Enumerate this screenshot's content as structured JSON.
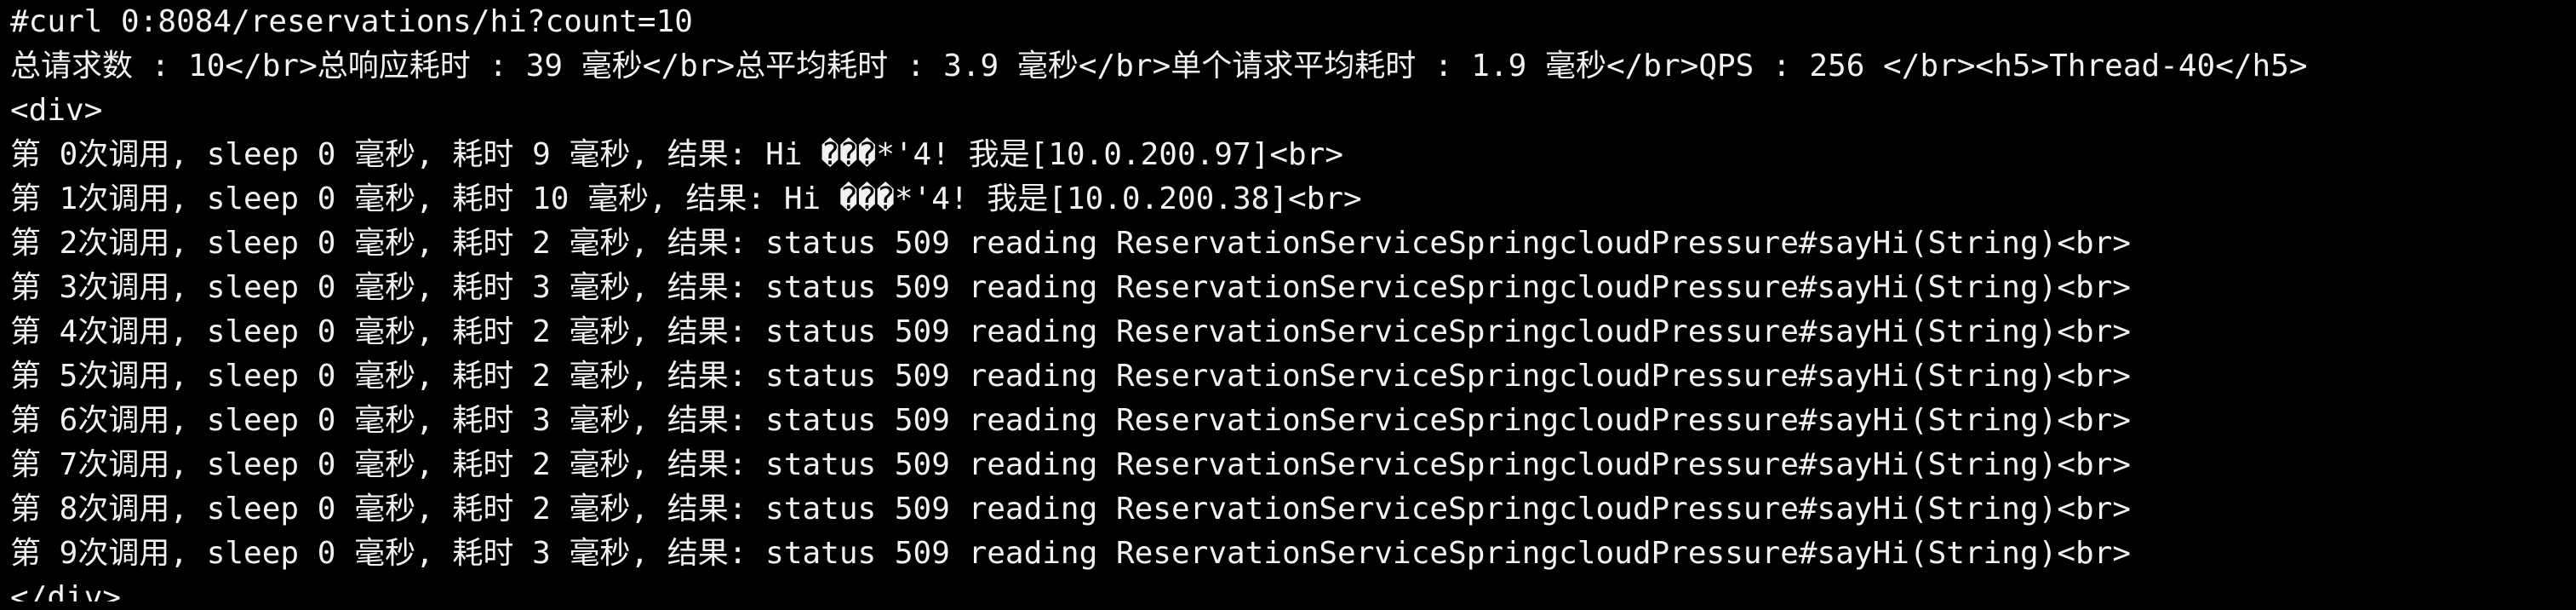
{
  "terminal": {
    "lines": [
      "#curl 0:8084/reservations/hi?count=10",
      "总请求数 : 10</br>总响应耗时 : 39 毫秒</br>总平均耗时 : 3.9 毫秒</br>单个请求平均耗时 : 1.9 毫秒</br>QPS : 256 </br><h5>Thread-40</h5>",
      "<div>",
      "第 0次调用, sleep 0 毫秒, 耗时 9 毫秒, 结果: Hi ���*'4! 我是[10.0.200.97]<br>",
      "第 1次调用, sleep 0 毫秒, 耗时 10 毫秒, 结果: Hi ���*'4! 我是[10.0.200.38]<br>",
      "第 2次调用, sleep 0 毫秒, 耗时 2 毫秒, 结果: status 509 reading ReservationServiceSpringcloudPressure#sayHi(String)<br>",
      "第 3次调用, sleep 0 毫秒, 耗时 3 毫秒, 结果: status 509 reading ReservationServiceSpringcloudPressure#sayHi(String)<br>",
      "第 4次调用, sleep 0 毫秒, 耗时 2 毫秒, 结果: status 509 reading ReservationServiceSpringcloudPressure#sayHi(String)<br>",
      "第 5次调用, sleep 0 毫秒, 耗时 2 毫秒, 结果: status 509 reading ReservationServiceSpringcloudPressure#sayHi(String)<br>",
      "第 6次调用, sleep 0 毫秒, 耗时 3 毫秒, 结果: status 509 reading ReservationServiceSpringcloudPressure#sayHi(String)<br>",
      "第 7次调用, sleep 0 毫秒, 耗时 2 毫秒, 结果: status 509 reading ReservationServiceSpringcloudPressure#sayHi(String)<br>",
      "第 8次调用, sleep 0 毫秒, 耗时 2 毫秒, 结果: status 509 reading ReservationServiceSpringcloudPressure#sayHi(String)<br>",
      "第 9次调用, sleep 0 毫秒, 耗时 3 毫秒, 结果: status 509 reading ReservationServiceSpringcloudPressure#sayHi(String)<br>",
      "</div>"
    ]
  }
}
